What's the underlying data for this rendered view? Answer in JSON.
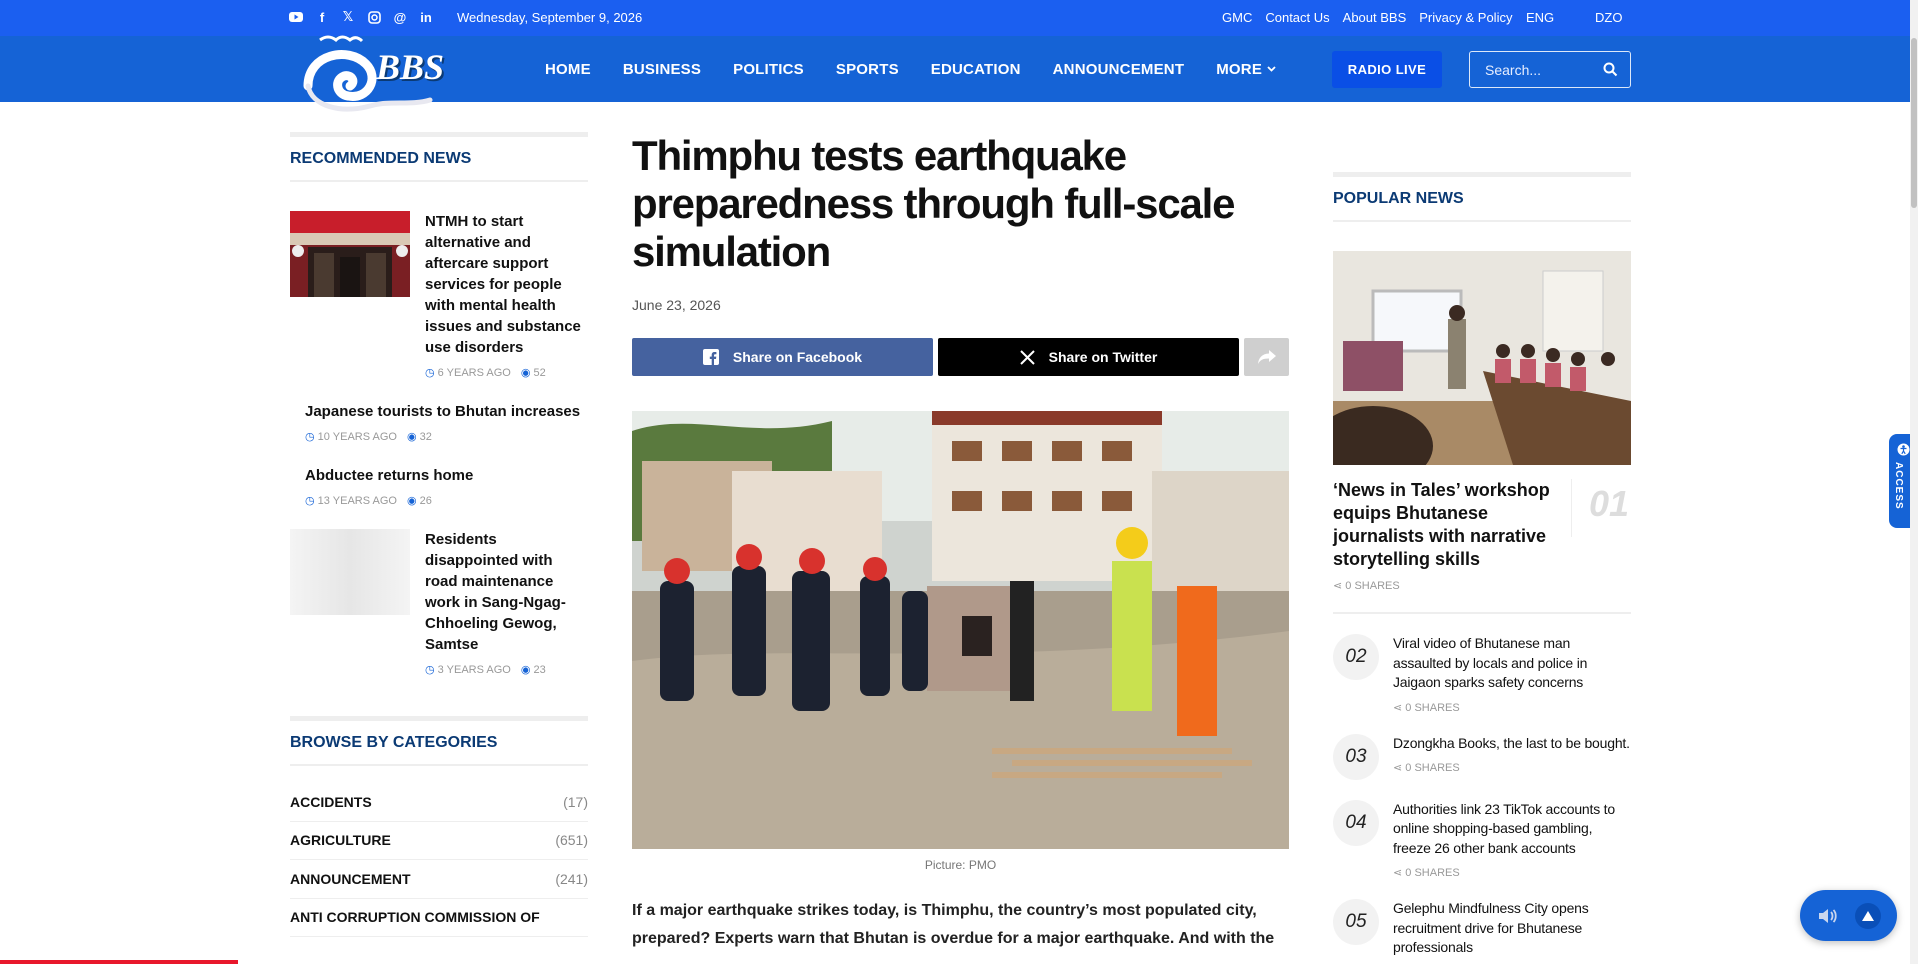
{
  "topbar": {
    "social": [
      "youtube-icon",
      "facebook-icon",
      "x-icon",
      "instagram-icon",
      "threads-icon",
      "linkedin-icon"
    ],
    "date": "Wednesday, September 9, 2026",
    "links": [
      "GMC",
      "Contact Us",
      "About BBS",
      "Privacy & Policy"
    ],
    "lang_eng": "ENG",
    "lang_dzo": "DZO"
  },
  "header": {
    "logo_text": "BBS",
    "nav": [
      "HOME",
      "BUSINESS",
      "POLITICS",
      "SPORTS",
      "EDUCATION",
      "ANNOUNCEMENT",
      "MORE"
    ],
    "radio_label": "RADIO LIVE",
    "search_placeholder": "Search..."
  },
  "recommended": {
    "title": "RECOMMENDED NEWS",
    "items": [
      {
        "title": "NTMH to start alternative and aftercare support services for people with mental health issues and substance use disorders",
        "age": "6 YEARS AGO",
        "views": "52"
      },
      {
        "title": "Japanese tourists to Bhutan increases",
        "age": "10 YEARS AGO",
        "views": "32"
      },
      {
        "title": "Abductee returns home",
        "age": "13 YEARS AGO",
        "views": "26"
      },
      {
        "title": "Residents disappointed with road maintenance work in Sang-Ngag-Chhoeling Gewog, Samtse",
        "age": "3 YEARS AGO",
        "views": "23"
      }
    ]
  },
  "categories": {
    "title": "BROWSE BY CATEGORIES",
    "items": [
      {
        "name": "ACCIDENTS",
        "count": "(17)"
      },
      {
        "name": "AGRICULTURE",
        "count": "(651)"
      },
      {
        "name": "ANNOUNCEMENT",
        "count": "(241)"
      },
      {
        "name": "ANTI CORRUPTION COMMISSION OF",
        "count": ""
      }
    ]
  },
  "article": {
    "headline": "Thimphu tests earthquake preparedness through full-scale simulation",
    "date": "June 23, 2026",
    "share_facebook": "Share on Facebook",
    "share_twitter": "Share on Twitter",
    "caption": "Picture: PMO",
    "body": "If a major earthquake strikes today, is Thimphu, the country’s most populated city, prepared? Experts warn that Bhutan is overdue for a major earthquake. And with the"
  },
  "popular": {
    "title": "POPULAR NEWS",
    "main": {
      "title": "‘News in Tales’ workshop equips Bhutanese journalists with narrative storytelling skills",
      "num": "01",
      "shares": "0 SHARES"
    },
    "items": [
      {
        "num": "02",
        "title": "Viral video of Bhutanese man assaulted by locals and police in Jaigaon sparks safety concerns",
        "shares": "0 SHARES"
      },
      {
        "num": "03",
        "title": "Dzongkha Books, the last to be bought.",
        "shares": "0 SHARES"
      },
      {
        "num": "04",
        "title": "Authorities link 23 TikTok accounts to online shopping-based gambling, freeze 26 other bank accounts",
        "shares": "0 SHARES"
      },
      {
        "num": "05",
        "title": "Gelephu Mindfulness City opens recruitment drive for Bhutanese professionals",
        "shares": ""
      }
    ]
  },
  "widgets": {
    "access_label": "ACCESS"
  },
  "colors": {
    "topbar": "#1b5ff0",
    "header": "#1563d6",
    "accent": "#0b3a74",
    "progress": "#e8172b"
  }
}
